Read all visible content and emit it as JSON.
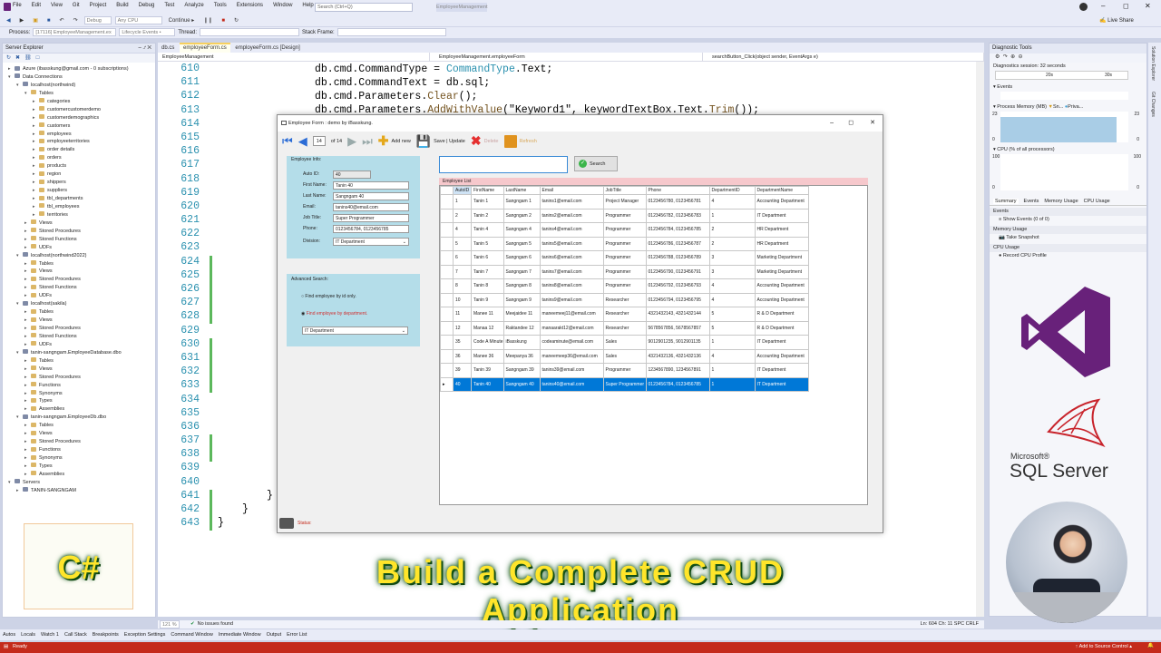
{
  "menu": [
    "File",
    "Edit",
    "View",
    "Git",
    "Project",
    "Build",
    "Debug",
    "Test",
    "Analyze",
    "Tools",
    "Extensions",
    "Window",
    "Help"
  ],
  "search_placeholder": "Search (Ctrl+Q)",
  "solution_name": "EmployeeManagement",
  "live_share": "Live Share",
  "toolbar": {
    "config": "Debug",
    "platform": "Any CPU",
    "continue": "Continue ▸",
    "process_label": "Process:",
    "process": "[17116] EmployeeManagement.ex",
    "lifecycle": "Lifecycle Events •",
    "thread": "Thread:",
    "stack_frame": "Stack Frame:"
  },
  "server_explorer": {
    "title": "Server Explorer",
    "nodes": [
      {
        "t": "Azure (ibasskung@gmail.com - 0 subscriptions)",
        "l": 0,
        "e": "▸"
      },
      {
        "t": "Data Connections",
        "l": 0,
        "e": "▾"
      },
      {
        "t": "localhost(northwind)",
        "l": 1,
        "e": "▾"
      },
      {
        "t": "Tables",
        "l": 2,
        "e": "▾"
      },
      {
        "t": "categories",
        "l": 3,
        "e": "▸"
      },
      {
        "t": "customercustomerdemo",
        "l": 3,
        "e": "▸"
      },
      {
        "t": "customerdemographics",
        "l": 3,
        "e": "▸"
      },
      {
        "t": "customers",
        "l": 3,
        "e": "▸"
      },
      {
        "t": "employees",
        "l": 3,
        "e": "▸"
      },
      {
        "t": "employeeterritories",
        "l": 3,
        "e": "▸"
      },
      {
        "t": "order details",
        "l": 3,
        "e": "▸"
      },
      {
        "t": "orders",
        "l": 3,
        "e": "▸"
      },
      {
        "t": "products",
        "l": 3,
        "e": "▸"
      },
      {
        "t": "region",
        "l": 3,
        "e": "▸"
      },
      {
        "t": "shippers",
        "l": 3,
        "e": "▸"
      },
      {
        "t": "suppliers",
        "l": 3,
        "e": "▸"
      },
      {
        "t": "tbl_departments",
        "l": 3,
        "e": "▸"
      },
      {
        "t": "tbl_employees",
        "l": 3,
        "e": "▸"
      },
      {
        "t": "territories",
        "l": 3,
        "e": "▸"
      },
      {
        "t": "Views",
        "l": 2,
        "e": "▸"
      },
      {
        "t": "Stored Procedures",
        "l": 2,
        "e": "▸"
      },
      {
        "t": "Stored Functions",
        "l": 2,
        "e": "▸"
      },
      {
        "t": "UDFs",
        "l": 2,
        "e": "▸"
      },
      {
        "t": "localhost(northwind2022)",
        "l": 1,
        "e": "▾"
      },
      {
        "t": "Tables",
        "l": 2,
        "e": "▸"
      },
      {
        "t": "Views",
        "l": 2,
        "e": "▸"
      },
      {
        "t": "Stored Procedures",
        "l": 2,
        "e": "▸"
      },
      {
        "t": "Stored Functions",
        "l": 2,
        "e": "▸"
      },
      {
        "t": "UDFs",
        "l": 2,
        "e": "▸"
      },
      {
        "t": "localhost(sakila)",
        "l": 1,
        "e": "▾"
      },
      {
        "t": "Tables",
        "l": 2,
        "e": "▸"
      },
      {
        "t": "Views",
        "l": 2,
        "e": "▸"
      },
      {
        "t": "Stored Procedures",
        "l": 2,
        "e": "▸"
      },
      {
        "t": "Stored Functions",
        "l": 2,
        "e": "▸"
      },
      {
        "t": "UDFs",
        "l": 2,
        "e": "▸"
      },
      {
        "t": "tanin-sangngam.EmployeeDatabase.dbo",
        "l": 1,
        "e": "▾"
      },
      {
        "t": "Tables",
        "l": 2,
        "e": "▸"
      },
      {
        "t": "Views",
        "l": 2,
        "e": "▸"
      },
      {
        "t": "Stored Procedures",
        "l": 2,
        "e": "▸"
      },
      {
        "t": "Functions",
        "l": 2,
        "e": "▸"
      },
      {
        "t": "Synonyms",
        "l": 2,
        "e": "▸"
      },
      {
        "t": "Types",
        "l": 2,
        "e": "▸"
      },
      {
        "t": "Assemblies",
        "l": 2,
        "e": "▸"
      },
      {
        "t": "tanin-sangngam.EmployeeDb.dbo",
        "l": 1,
        "e": "▾"
      },
      {
        "t": "Tables",
        "l": 2,
        "e": "▸"
      },
      {
        "t": "Views",
        "l": 2,
        "e": "▸"
      },
      {
        "t": "Stored Procedures",
        "l": 2,
        "e": "▸"
      },
      {
        "t": "Functions",
        "l": 2,
        "e": "▸"
      },
      {
        "t": "Synonyms",
        "l": 2,
        "e": "▸"
      },
      {
        "t": "Types",
        "l": 2,
        "e": "▸"
      },
      {
        "t": "Assemblies",
        "l": 2,
        "e": "▸"
      },
      {
        "t": "Servers",
        "l": 0,
        "e": "▾"
      },
      {
        "t": "TANIN-SANGNGAM",
        "l": 1,
        "e": "▸"
      }
    ]
  },
  "csharp_logo": "C#",
  "editor_tabs": [
    "db.cs",
    "employeeForm.cs",
    "employeeForm.cs [Design]"
  ],
  "nav": [
    "EmployeeManagement",
    "EmployeeManagement.employeeForm",
    "searchButton_Click(object sender, EventArgs e)"
  ],
  "line_numbers": [
    "610",
    "611",
    "612",
    "613",
    "614",
    "615",
    "616",
    "617",
    "618",
    "619",
    "620",
    "621",
    "622",
    "623",
    "624",
    "625",
    "626",
    "627",
    "628",
    "629",
    "630",
    "631",
    "632",
    "633",
    "634",
    "635",
    "636",
    "637",
    "638",
    "639",
    "640",
    "641",
    "642",
    "643"
  ],
  "code": {
    "l610a": "db.cmd.CommandType = ",
    "l610b": "CommandType",
    "l610c": ".Text;",
    "l611a": "db.cmd.CommandText = db.sql;",
    "l612a": "db.cmd.Parameters.",
    "l612b": "Clear",
    "l612c": "();",
    "l613a": "db.cmd.Parameters.",
    "l613b": "AddWithValue",
    "l613c": "(\"Keyword1\", keywordTextBox.Text.",
    "l613d": "Trim",
    "l613e": "());",
    "l641": "}",
    "l642": "}",
    "l643": "}"
  },
  "form": {
    "title": "Employee Form : demo by iBasskung.",
    "nav_pos": "14",
    "nav_of": "of 14",
    "add": "Add new",
    "save": "Save | Update",
    "delete": "Delete",
    "refresh": "Refresh",
    "info_title": "Employee Info:",
    "labels": [
      "Auto ID:",
      "First Name:",
      "Last Name:",
      "Email:",
      "Job Title:",
      "Phone:",
      "Division:"
    ],
    "values": [
      "40",
      "Tanin 40",
      "Sangngam 40",
      "tanins40@email.com",
      "Super Programmer",
      "0123456784, 0123456785",
      "IT Department"
    ],
    "adv_title": "Advanced Search:",
    "radio1": "Find employee by id only.",
    "radio2": "Find employee by department.",
    "adv_select": "IT Department",
    "search_btn": "Search",
    "list_label": "Employee List",
    "status": "Status:"
  },
  "grid": {
    "headers": [
      "AutoID",
      "FirstName",
      "LastName",
      "Email",
      "JobTitle",
      "Phone",
      "DepartmentID",
      "DepartmentName"
    ],
    "rows": [
      [
        "1",
        "Tanin 1",
        "Sangngam 1",
        "tanins1@email.com",
        "Project Manager",
        "0123456780, 0123456781",
        "4",
        "Accounting Department"
      ],
      [
        "2",
        "Tanin 2",
        "Sangngam 2",
        "tanins2@email.com",
        "Programmer",
        "0123456782, 0123456783",
        "1",
        "IT Department"
      ],
      [
        "4",
        "Tanin 4",
        "Sangngam 4",
        "tanins4@email.com",
        "Programmer",
        "0123456784, 0123456785",
        "2",
        "HR Department"
      ],
      [
        "5",
        "Tanin 5",
        "Sangngam 5",
        "tanins5@email.com",
        "Programmer",
        "0123456786, 0123456787",
        "2",
        "HR Department"
      ],
      [
        "6",
        "Tanin 6",
        "Sangngam 6",
        "tanins6@email.com",
        "Programmer",
        "0123456788, 0123456789",
        "3",
        "Marketing Department"
      ],
      [
        "7",
        "Tanin 7",
        "Sangngam 7",
        "tanins7@email.com",
        "Programmer",
        "0123456790, 0123456791",
        "3",
        "Marketing Department"
      ],
      [
        "8",
        "Tanin 8",
        "Sangngam 8",
        "tanins8@email.com",
        "Programmer",
        "0123456792, 0123456793",
        "4",
        "Accounting Department"
      ],
      [
        "10",
        "Tanin 9",
        "Sangngam 9",
        "tanins9@email.com",
        "Researcher",
        "0123456794, 0123456795",
        "4",
        "Accounting Department"
      ],
      [
        "11",
        "Manee 11",
        "Meejaidee 11",
        "maneemeej11@email.com",
        "Researcher",
        "4321432143, 4321432144",
        "5",
        "R & D Department"
      ],
      [
        "12",
        "Manaa 12",
        "Raktandee 12",
        "manaarakt12@email.com",
        "Researcher",
        "5678567856, 5678567857",
        "5",
        "R & D Department"
      ],
      [
        "35",
        "Code A Minute",
        "iBasskung",
        "codeaminute@email.com",
        "Sales",
        "9012901235, 9012901135",
        "1",
        "IT Department"
      ],
      [
        "36",
        "Manee 36",
        "Meepanya 36",
        "maneemeep36@email.com",
        "Sales",
        "4321432136, 4321432136",
        "4",
        "Accounting Department"
      ],
      [
        "39",
        "Tanin 39",
        "Sangngam 39",
        "tanins39@email.com",
        "Programmer",
        "1234567890, 1234567891",
        "1",
        "IT Department"
      ],
      [
        "40",
        "Tanin 40",
        "Sangngam 40",
        "tanins40@email.com",
        "Super Programmer",
        "0123456784, 0123456785",
        "1",
        "IT Department"
      ]
    ],
    "selected": 13
  },
  "diag": {
    "title": "Diagnostic Tools",
    "session": "Diagnostics session: 32 seconds",
    "t20": "20s",
    "t30": "30s",
    "events": "Events",
    "process_memory": "Process Memory (MB)",
    "snap": "Sn...",
    "priv": "Priva...",
    "mem_max": "23",
    "mem_min": "0",
    "cpu": "CPU (% of all processors)",
    "cpu_max": "100",
    "cpu_min": "0",
    "tabs": [
      "Summary",
      "Events",
      "Memory Usage",
      "CPU Usage"
    ],
    "events_h": "Events",
    "show_events": "Show Events (0 of 0)",
    "mem_h": "Memory Usage",
    "take_snapshot": "Take Snapshot",
    "cpu_h": "CPU Usage",
    "record_cpu": "Record CPU Profile"
  },
  "vertical_tabs": [
    "Solution Explorer",
    "Git Changes"
  ],
  "sql_microsoft": "Microsoft®",
  "sql_server": "SQL Server",
  "caption": "Build a Complete CRUD Application",
  "editor_status": {
    "zoom": "121 %",
    "issues": "No issues found",
    "pos": "Ln: 604   Ch: 11   SPC   CRLF"
  },
  "bottom_tabs": [
    "Autos",
    "Locals",
    "Watch 1",
    "Call Stack",
    "Breakpoints",
    "Exception Settings",
    "Command Window",
    "Immediate Window",
    "Output",
    "Error List"
  ],
  "status": {
    "ready": "Ready",
    "source": "↑ Add to Source Control ▴"
  },
  "colors": {
    "accent": "#c42b1c",
    "selected": "#0078d7",
    "vs_purple": "#68217a"
  }
}
